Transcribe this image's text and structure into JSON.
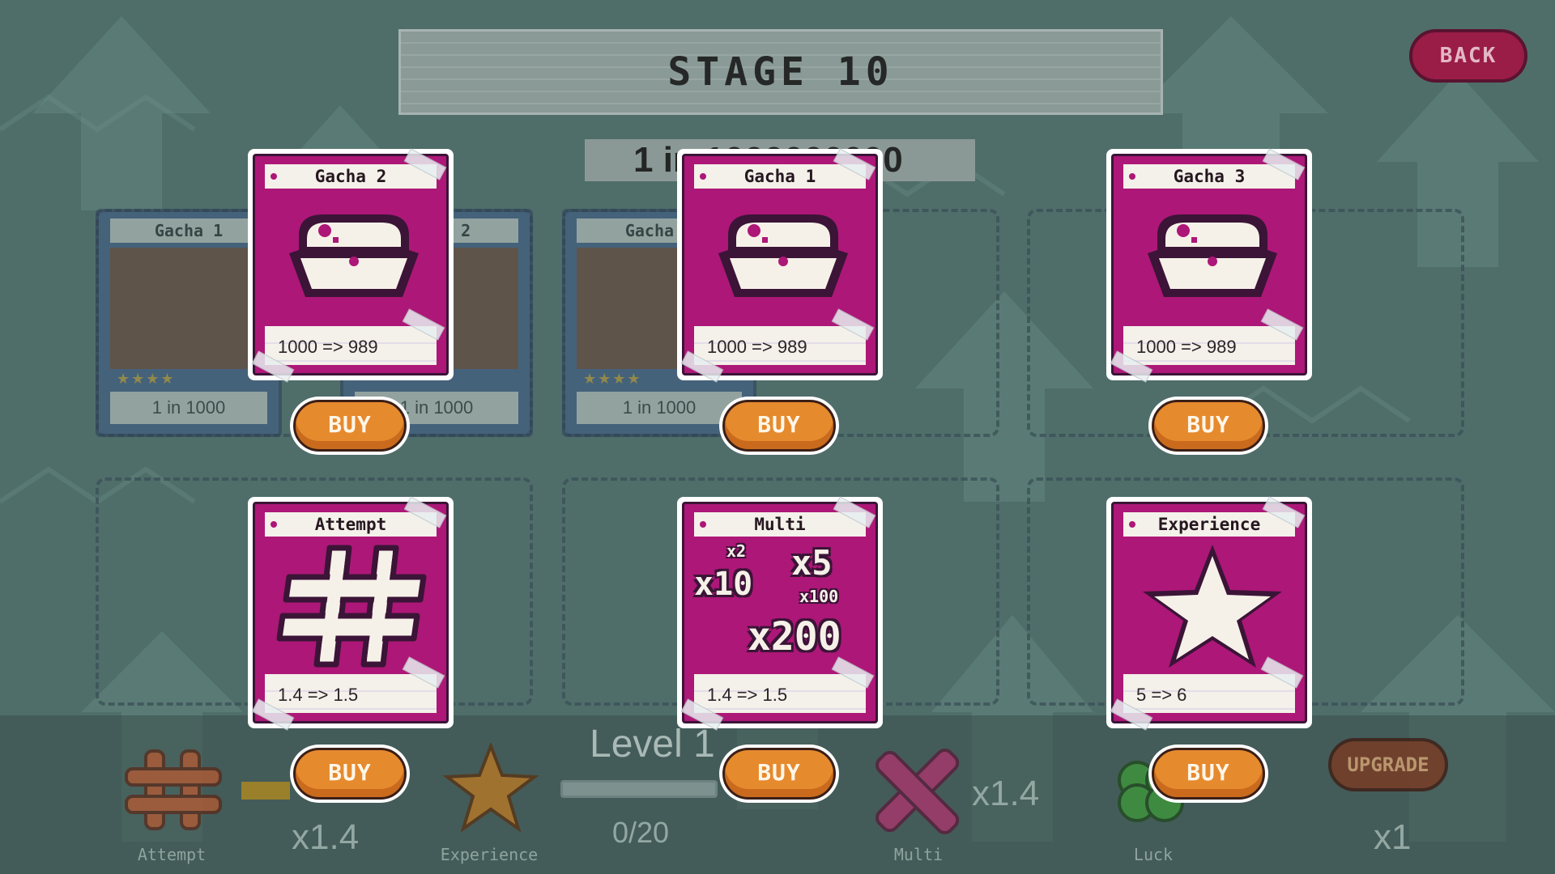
{
  "header": {
    "stage_title": "STAGE 10",
    "odds_text": "1 in 1000000000",
    "back_label": "BACK"
  },
  "owned_cards": [
    {
      "title": "Gacha 1",
      "value": "1 in 1000"
    },
    {
      "title": "Gacha 2",
      "value": "1 in 1000"
    },
    {
      "title": "Gacha 1",
      "value": "1 in 1000"
    }
  ],
  "shop": {
    "gacha_cards": [
      {
        "title": "Gacha 2",
        "value": "1000 => 989",
        "icon": "chest-icon",
        "buy_label": "BUY"
      },
      {
        "title": "Gacha 1",
        "value": "1000 => 989",
        "icon": "chest-icon",
        "buy_label": "BUY"
      },
      {
        "title": "Gacha 3",
        "value": "1000 => 989",
        "icon": "chest-icon",
        "buy_label": "BUY"
      }
    ],
    "upgrade_cards": [
      {
        "title": "Attempt",
        "value": "1.4 => 1.5",
        "icon": "hash-icon",
        "buy_label": "BUY"
      },
      {
        "title": "Multi",
        "value": "1.4 => 1.5",
        "icon": "multiplier-icon",
        "buy_label": "BUY",
        "multipliers": [
          "x2",
          "x5",
          "x10",
          "x100",
          "x200"
        ]
      },
      {
        "title": "Experience",
        "value": "5 => 6",
        "icon": "star-icon",
        "buy_label": "BUY"
      }
    ]
  },
  "bottom_bar": {
    "attempt": {
      "label": "Attempt",
      "mult": "x1.4"
    },
    "experience": {
      "label": "Experience"
    },
    "level": {
      "text": "Level 1",
      "exp": "0/20",
      "progress": 0
    },
    "multi": {
      "label": "Multi",
      "mult": "x1.4"
    },
    "luck": {
      "label": "Luck",
      "mult": "x1"
    },
    "upgrade_label": "UPGRADE"
  },
  "colors": {
    "card_magenta": "#ad1777",
    "buy_orange": "#e68a2e",
    "back_red": "#9a1d47",
    "background_teal": "#4f6e6a"
  }
}
